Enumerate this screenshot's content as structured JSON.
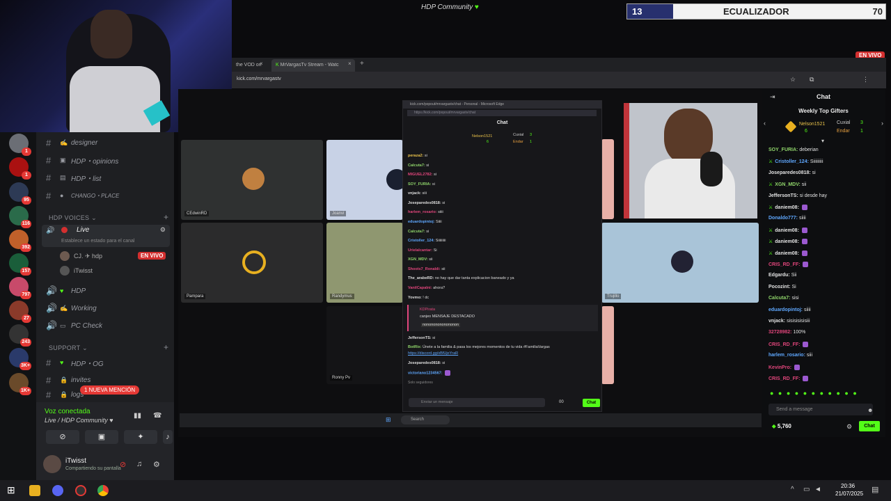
{
  "overlay": {
    "community_title": "HDP Community",
    "heart": "♥",
    "equalizer_number": "13",
    "equalizer_title": "ECUALIZADOR",
    "equalizer_score": "70",
    "live_badge": "EN VIVO"
  },
  "discord": {
    "servers": [
      {
        "badge": "1"
      },
      {
        "badge": "1"
      },
      {
        "badge": "95"
      },
      {
        "badge": "116"
      },
      {
        "badge": "392"
      },
      {
        "badge": "157"
      },
      {
        "badge": "797"
      },
      {
        "badge": "27"
      },
      {
        "badge": "243"
      },
      {
        "badge": "3K+"
      },
      {
        "badge": "1K+"
      }
    ],
    "channels_top": [
      {
        "emoji": "✍",
        "name": "designer"
      },
      {
        "emoji": "▣",
        "name": "HDP・opinions"
      },
      {
        "emoji": "▤",
        "name": "HDP・list"
      },
      {
        "emoji": "●",
        "name": "CHANGO・PLACE"
      }
    ],
    "voices_category": "HDP VOICES",
    "live_channel": "Live",
    "live_status": "Establece un estado para el canal",
    "voice_users": [
      {
        "name": "CJ. ✈ hdp",
        "badge": "EN VIVO"
      },
      {
        "name": "iTwisst",
        "badge": ""
      }
    ],
    "voice_channels": [
      {
        "emoji": "♥",
        "name": "HDP"
      },
      {
        "emoji": "✍",
        "name": "Working"
      },
      {
        "emoji": "▭",
        "name": "PC Check"
      }
    ],
    "support_category": "SUPPORT",
    "support_channels": [
      {
        "emoji": "♥",
        "name": "HDP・OG"
      },
      {
        "emoji": "🔒",
        "name": "invites"
      },
      {
        "emoji": "🔒",
        "name": "logs"
      }
    ],
    "mention_badge": "1 NUEVA MENCIÓN",
    "voice_connected": "Voz conectada",
    "voice_location": "Live / HDP Community ♥",
    "user_name": "iTwisst",
    "user_status": "Compartiendo su pantalla"
  },
  "browser": {
    "tabs": [
      {
        "label": "the VOD on"
      },
      {
        "label": "MrVargasTv Stream - Watc"
      }
    ],
    "url": "kick.com/mrvargastv"
  },
  "stage": {
    "tiles": [
      {
        "name": "CEdwinRD"
      },
      {
        "name": "Joanvi"
      },
      {
        "name": "Pampara"
      },
      {
        "name": "Randymus"
      },
      {
        "name": "Trujillo"
      },
      {
        "name": "Ronny Pv"
      }
    ]
  },
  "popout": {
    "title_bar": "kick.com/popout/mrvargastv/chat - Personal - Microsoft Edge",
    "url": "https://kick.com/popout/mrvargastv/chat",
    "header": "Chat",
    "gifters": [
      {
        "name": "Nelson1521",
        "count": "6"
      },
      {
        "name": "Cuxial",
        "count": "3"
      },
      {
        "name": "Endar",
        "count": "1"
      }
    ],
    "messages": [
      {
        "user": "peraza2:",
        "text": "si",
        "color": "#e8c14a"
      },
      {
        "user": "Calcuta7:",
        "text": "si",
        "color": "#8fd46a"
      },
      {
        "user": "MIGUEL2782:",
        "text": "si",
        "color": "#e0457b"
      },
      {
        "user": "SOY_FURIA:",
        "text": "si",
        "color": "#8fd46a"
      },
      {
        "user": "vnjack:",
        "text": "siii",
        "color": "#dddddd"
      },
      {
        "user": "Joseparedes0818:",
        "text": "si",
        "color": "#dddddd"
      },
      {
        "user": "harlem_rosario:",
        "text": "siiii",
        "color": "#e0457b"
      },
      {
        "user": "eduardopintoj:",
        "text": "Siiii",
        "color": "#5fa8ff"
      },
      {
        "user": "Calcuta7:",
        "text": "si",
        "color": "#8fd46a"
      },
      {
        "user": "Cristoller_124:",
        "text": "Siiiiiiiii",
        "color": "#5fa8ff"
      },
      {
        "user": "Urielalcantar:",
        "text": "Si",
        "color": "#e0457b"
      },
      {
        "user": "XGN_MDV:",
        "text": "sii",
        "color": "#8fd46a"
      },
      {
        "user": "Shoots7_Ronaldi:",
        "text": "sii",
        "color": "#e0457b"
      },
      {
        "user": "The_arabeRD:",
        "text": "no hay que dar tanta explicacion baneado y ya",
        "color": "#dddddd"
      },
      {
        "user": "VanilCapaIni:",
        "text": "ahora?",
        "color": "#e0457b"
      },
      {
        "user": "Yovmo:",
        "text": "! dc",
        "color": "#dddddd"
      }
    ],
    "highlight_user": "KDPirata",
    "highlight_label": "canjeo MENSAJE DESTACADO",
    "highlight_text": "nonononononononon",
    "messages2": [
      {
        "user": "JeffersonTS:",
        "text": "si",
        "color": "#dddddd"
      },
      {
        "user": "BotRix:",
        "text": "Únete a la familia & pasa los mejores momentos de tu vida #FamiliaVargas",
        "color": "#8fd46a"
      },
      {
        "user": "",
        "text": "https://discord.gg/xBfUjoYraR",
        "color": "#5fa8ff"
      },
      {
        "user": "Joseparedes0818:",
        "text": "si",
        "color": "#dddddd"
      },
      {
        "user": "victoriano1234567:",
        "text": "",
        "color": "#5fa8ff"
      }
    ],
    "followers_only": "Solo seguidores",
    "input_placeholder": "Enviar un mensaje",
    "chat_button": "Chat",
    "counter": "00"
  },
  "kick_chat": {
    "header": "Chat",
    "weekly_title": "Weekly Top Gifters",
    "gifters": [
      {
        "name": "Nelson1521",
        "count": "6"
      },
      {
        "name": "Cuxial",
        "count": "3"
      },
      {
        "name": "Endar",
        "count": "1"
      }
    ],
    "messages": [
      {
        "user": "SOY_FURIA:",
        "text": "deberian",
        "color": "#8fd46a",
        "badge": false,
        "emote": false
      },
      {
        "user": "Cristoller_124:",
        "text": "Siiiiiiiii",
        "color": "#5fa8ff",
        "badge": true,
        "emote": false
      },
      {
        "user": "Joseparedes0818:",
        "text": "si",
        "color": "#e2e2e2",
        "badge": false,
        "emote": false
      },
      {
        "user": "XGN_MDV:",
        "text": "sii",
        "color": "#8fd46a",
        "badge": true,
        "emote": false
      },
      {
        "user": "JeffersonTS:",
        "text": "si desde hay",
        "color": "#e2e2e2",
        "badge": false,
        "emote": false
      },
      {
        "user": "daniem08:",
        "text": "",
        "color": "#e2e2e2",
        "badge": true,
        "emote": true
      },
      {
        "user": "Donaldo777:",
        "text": "siiii",
        "color": "#5fa8ff",
        "badge": false,
        "emote": false
      },
      {
        "user": "daniem08:",
        "text": "",
        "color": "#e2e2e2",
        "badge": true,
        "emote": true
      },
      {
        "user": "daniem08:",
        "text": "",
        "color": "#e2e2e2",
        "badge": true,
        "emote": true
      },
      {
        "user": "daniem08:",
        "text": "",
        "color": "#e2e2e2",
        "badge": true,
        "emote": true
      },
      {
        "user": "CRIS_RD_FF:",
        "text": "",
        "color": "#e0457b",
        "badge": false,
        "emote": true
      },
      {
        "user": "Edgardu:",
        "text": "Sii",
        "color": "#e2e2e2",
        "badge": false,
        "emote": false
      },
      {
        "user": "Pocozint:",
        "text": "Si",
        "color": "#e2e2e2",
        "badge": false,
        "emote": false
      },
      {
        "user": "Calcuta7:",
        "text": "sisi",
        "color": "#8fd46a",
        "badge": false,
        "emote": false
      },
      {
        "user": "eduardopintoj:",
        "text": "siiii",
        "color": "#5fa8ff",
        "badge": false,
        "emote": false
      },
      {
        "user": "vnjack:",
        "text": "sisisisisisiii",
        "color": "#e2e2e2",
        "badge": false,
        "emote": false
      },
      {
        "user": "32728982:",
        "text": "100%",
        "color": "#e0457b",
        "badge": false,
        "emote": false
      },
      {
        "user": "CRIS_RD_FF:",
        "text": "",
        "color": "#e0457b",
        "badge": false,
        "emote": true
      },
      {
        "user": "harlem_rosario:",
        "text": "siii",
        "color": "#5fa8ff",
        "badge": false,
        "emote": false
      },
      {
        "user": "KevinPro:",
        "text": "",
        "color": "#e0457b",
        "badge": false,
        "emote": true
      },
      {
        "user": "CRIS_RD_FF:",
        "text": "",
        "color": "#e0457b",
        "badge": false,
        "emote": true
      }
    ],
    "input_placeholder": "Send a message",
    "kicks": "5,760",
    "chat_button": "Chat"
  },
  "taskbar": {
    "time": "20:36",
    "date": "21/07/2025",
    "search": "Search"
  },
  "colors": {
    "kick_green": "#53fc18",
    "discord_bg": "#1e1f22",
    "live_red": "#d32f2f"
  }
}
